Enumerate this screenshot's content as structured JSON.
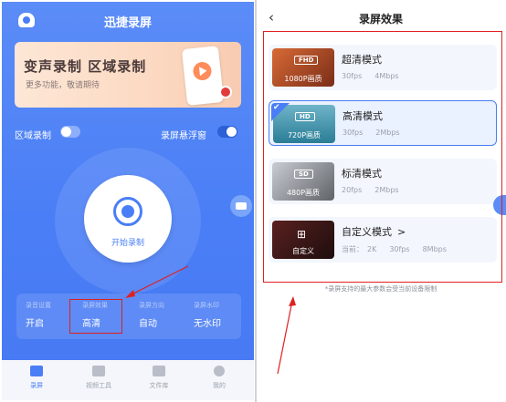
{
  "left": {
    "title": "迅捷录屏",
    "banner": {
      "title": "变声录制 区域录制",
      "subtitle": "更多功能，敬请期待"
    },
    "toggles": [
      {
        "label": "区域录制",
        "on": false
      },
      {
        "label": "录屏悬浮窗",
        "on": true
      }
    ],
    "record_button": {
      "label": "开始录制"
    },
    "settings": [
      {
        "label": "录音设置",
        "value": "开启"
      },
      {
        "label": "录屏效果",
        "value": "高清"
      },
      {
        "label": "录屏方向",
        "value": "自动"
      },
      {
        "label": "录屏水印",
        "value": "无水印"
      }
    ],
    "tabs": [
      {
        "label": "录屏",
        "icon": "video-camera-icon",
        "active": true
      },
      {
        "label": "视频工具",
        "icon": "toolbox-icon",
        "active": false
      },
      {
        "label": "文件库",
        "icon": "folder-icon",
        "active": false
      },
      {
        "label": "我的",
        "icon": "user-icon",
        "active": false
      }
    ]
  },
  "right": {
    "title": "录屏效果",
    "back_icon": "chevron-left-icon",
    "options": [
      {
        "name": "超清模式",
        "badge": "FHD",
        "caption": "1080P画质",
        "fps": "30fps",
        "bitrate": "4Mbps",
        "selected": false,
        "thumb_color": "#b8542a"
      },
      {
        "name": "高清模式",
        "badge": "HD",
        "caption": "720P画质",
        "fps": "30fps",
        "bitrate": "2Mbps",
        "selected": true,
        "thumb_color": "#3a8fa6"
      },
      {
        "name": "标清模式",
        "badge": "SD",
        "caption": "480P画质",
        "fps": "20fps",
        "bitrate": "2Mbps",
        "selected": false,
        "thumb_color": "#8a8f98"
      },
      {
        "name": "自定义模式",
        "badge": "",
        "caption": "自定义",
        "meta_prefix": "当前：",
        "resolution": "2K",
        "fps": "30fps",
        "bitrate": "8Mbps",
        "selected": false,
        "thumb_color": "#3a1c1c",
        "chevron": ">"
      }
    ],
    "note": "*录屏支持的最大参数会受当前设备限制"
  },
  "colors": {
    "primary": "#4a7ef6",
    "annotation": "#e02020"
  }
}
